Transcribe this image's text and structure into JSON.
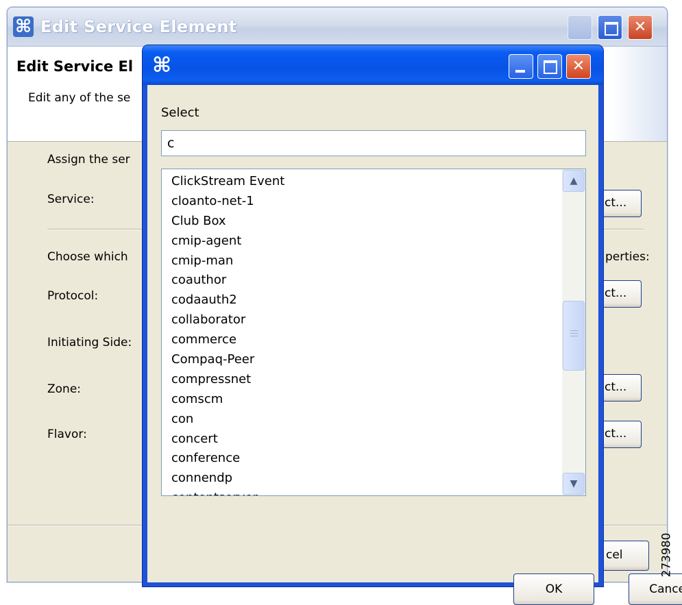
{
  "back_window": {
    "title": "Edit Service Element",
    "header_title": "Edit Service El",
    "header_desc": "Edit any of the se",
    "assign_label": "Assign the ser",
    "service_label": "Service:",
    "choose_label": "Choose which",
    "properties_tail": "perties:",
    "protocol_label": "Protocol:",
    "initiating_label": "Initiating Side:",
    "zone_label": "Zone:",
    "flavor_label": "Flavor:",
    "select_btn_tail": "ct...",
    "cancel_tail": "cel"
  },
  "dialog": {
    "section_label": "Select",
    "search_value": "c",
    "items": [
      "ClickStream Event",
      "cloanto-net-1",
      "Club Box",
      "cmip-agent",
      "cmip-man",
      "coauthor",
      "codaauth2",
      "collaborator",
      "commerce",
      "Compaq-Peer",
      "compressnet",
      "comscm",
      "con",
      "concert",
      "conference",
      "connendp",
      "contentserver"
    ],
    "ok_label": "OK",
    "cancel_label": "Cancel"
  },
  "figure_id": "273980",
  "colors": {
    "dialog_frame": "#1e52d8",
    "titlebar_blue": "#0853e6",
    "window_bg": "#ece9d8",
    "close_red": "#d14420"
  },
  "icons": [
    "app-icon",
    "minimize-icon",
    "maximize-icon",
    "close-icon",
    "scroll-up-icon",
    "scroll-down-icon"
  ]
}
